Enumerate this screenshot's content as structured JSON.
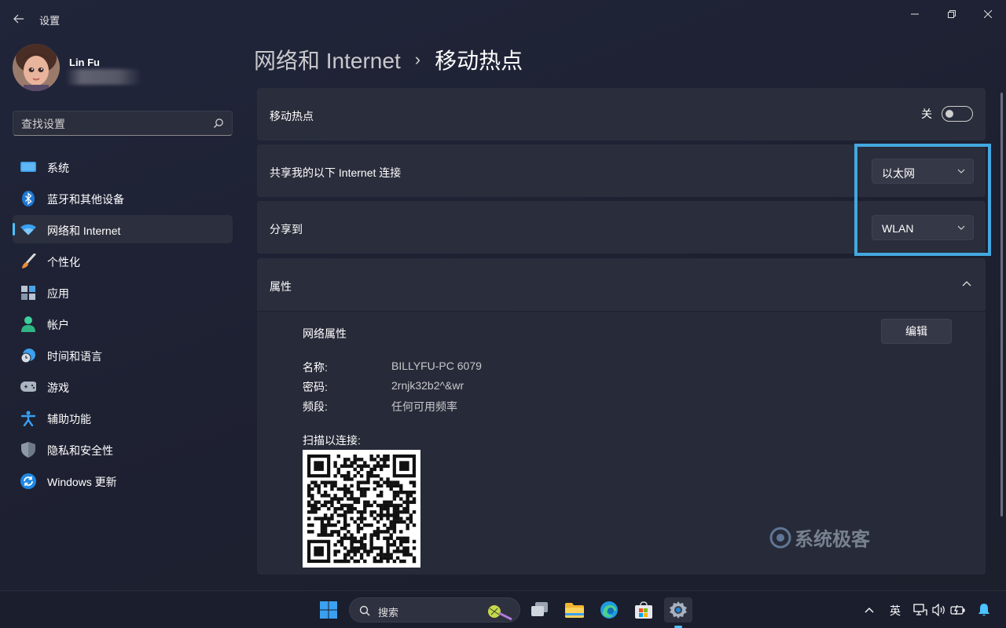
{
  "app": {
    "title": "设置"
  },
  "user": {
    "name": "Lin Fu"
  },
  "search": {
    "placeholder": "查找设置"
  },
  "nav": {
    "items": [
      {
        "label": "系统",
        "icon": "system-icon"
      },
      {
        "label": "蓝牙和其他设备",
        "icon": "bluetooth-icon"
      },
      {
        "label": "网络和 Internet",
        "icon": "wifi-icon",
        "active": true
      },
      {
        "label": "个性化",
        "icon": "brush-icon"
      },
      {
        "label": "应用",
        "icon": "apps-icon"
      },
      {
        "label": "帐户",
        "icon": "account-icon"
      },
      {
        "label": "时间和语言",
        "icon": "time-language-icon"
      },
      {
        "label": "游戏",
        "icon": "gamepad-icon"
      },
      {
        "label": "辅助功能",
        "icon": "accessibility-icon"
      },
      {
        "label": "隐私和安全性",
        "icon": "shield-icon"
      },
      {
        "label": "Windows 更新",
        "icon": "update-icon"
      }
    ]
  },
  "breadcrumb": {
    "parent": "网络和 Internet",
    "separator": "›",
    "current": "移动热点"
  },
  "hotspot": {
    "label": "移动热点",
    "state_text": "关",
    "enabled": false
  },
  "share_from": {
    "label": "共享我的以下 Internet 连接",
    "value": "以太网"
  },
  "share_to": {
    "label": "分享到",
    "value": "WLAN"
  },
  "properties": {
    "title": "属性",
    "network_props_label": "网络属性",
    "edit_label": "编辑",
    "name_label": "名称:",
    "name_value": "BILLYFU-PC 6079",
    "password_label": "密码:",
    "password_value": "2rnjk32b2^&wr",
    "band_label": "频段:",
    "band_value": "任何可用频率",
    "scan_label": "扫描以连接:"
  },
  "watermark": {
    "text": "系统极客"
  },
  "taskbar": {
    "search_label": "搜索",
    "ime": "英"
  },
  "colors": {
    "accent": "#4cc2ff",
    "highlight_box": "#43a8e0",
    "card": "#2a2d3b"
  }
}
